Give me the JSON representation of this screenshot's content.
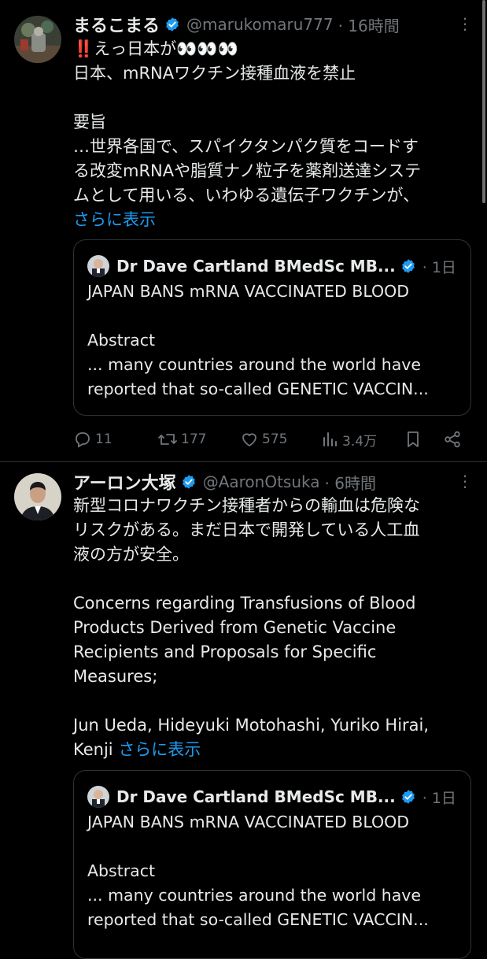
{
  "tweets": [
    {
      "author_name": "まるこまる",
      "handle": "@marukomaru777",
      "time": "· 16時間",
      "more": "⋮",
      "body_lines": [
        "‼️えっ日本が👀👀👀",
        "日本、mRNAワクチン接種血液を禁止",
        "",
        "要旨",
        "…世界各国で、スパイクタンパク質をコードす",
        "る改変mRNAや脂質ナノ粒子を薬剤送達システ",
        "ムとして用いる、いわゆる遺伝子ワクチンが、"
      ],
      "show_more": "さらに表示",
      "quote": {
        "author_name": "Dr Dave Cartland BMedSc MB...",
        "time": "· 1日",
        "lines": [
          "JAPAN BANS mRNA VACCINATED BLOOD",
          "",
          "Abstract",
          "... many countries around the world have",
          "reported that so-called GENETIC VACCIN..."
        ]
      },
      "actions": {
        "replies": "11",
        "reposts": "177",
        "likes": "575",
        "views": "3.4万"
      }
    },
    {
      "author_name": "アーロン大塚",
      "handle": "@AaronOtsuka",
      "time": "· 6時間",
      "more": "⋮",
      "body_lines": [
        "新型コロナワクチン接種者からの輸血は危険な",
        "リスクがある。まだ日本で開発している人工血",
        "液の方が安全。",
        "",
        "Concerns regarding Transfusions of Blood",
        "Products Derived from Genetic Vaccine",
        "Recipients and Proposals for Specific",
        "Measures;",
        "",
        "Jun Ueda, Hideyuki Motohashi, Yuriko Hirai,"
      ],
      "last_line_prefix": "Kenji ",
      "show_more": "さらに表示",
      "quote": {
        "author_name": "Dr Dave Cartland BMedSc MB...",
        "time": "· 1日",
        "lines": [
          "JAPAN BANS mRNA VACCINATED BLOOD",
          "",
          "Abstract",
          "... many countries around the world have",
          "reported that so-called GENETIC VACCIN..."
        ]
      }
    }
  ],
  "colors": {
    "background": "#000000",
    "text": "#e7e9ea",
    "muted": "#71767b",
    "link": "#1d9bf0",
    "border": "#2f3336",
    "verified": "#1d9bf0"
  }
}
